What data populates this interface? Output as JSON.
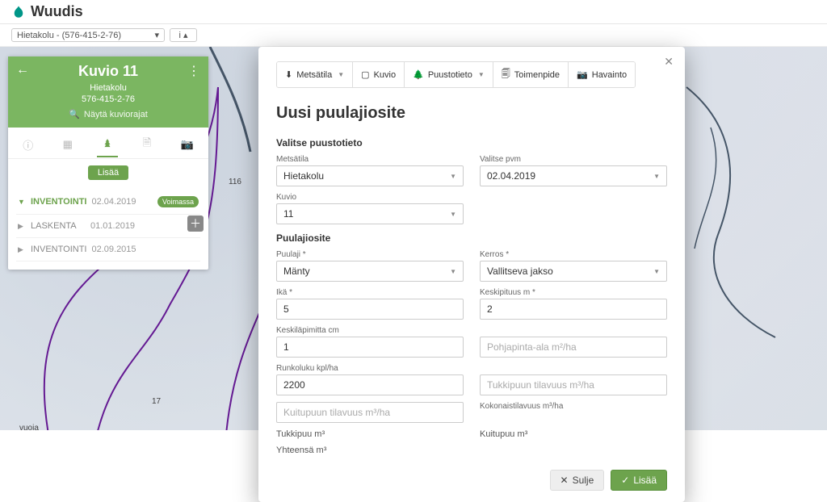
{
  "app": {
    "name": "Wuudis"
  },
  "property_selector": {
    "value": "Hietakolu - (576-415-2-76)"
  },
  "panel": {
    "title": "Kuvio 11",
    "estate": "Hietakolu",
    "estate_id": "576-415-2-76",
    "show_borders": "Näytä kuviorajat",
    "add_label": "Lisää",
    "items": [
      {
        "name": "INVENTOINTI",
        "date": "02.04.2019",
        "badge": "Voimassa",
        "active": true
      },
      {
        "name": "LASKENTA",
        "date": "01.01.2019",
        "badge": "",
        "active": false
      },
      {
        "name": "INVENTOINTI",
        "date": "02.09.2015",
        "badge": "",
        "active": false
      }
    ]
  },
  "modal": {
    "toolbar": {
      "metsatila": "Metsätila",
      "kuvio": "Kuvio",
      "puustotieto": "Puustotieto",
      "toimenpide": "Toimenpide",
      "havainto": "Havainto"
    },
    "title": "Uusi puulajiosite",
    "section_puustotieto": "Valitse puustotieto",
    "metsatila_label": "Metsätila",
    "metsatila_value": "Hietakolu",
    "pvm_label": "Valitse pvm",
    "pvm_value": "02.04.2019",
    "kuvio_label": "Kuvio",
    "kuvio_value": "11",
    "section_puulajiosite": "Puulajiosite",
    "puulaji_label": "Puulaji *",
    "puulaji_value": "Mänty",
    "kerros_label": "Kerros *",
    "kerros_value": "Vallitseva jakso",
    "ika_label": "Ikä *",
    "ika_value": "5",
    "keskipituus_label": "Keskipituus m *",
    "keskipituus_value": "2",
    "keskilapimitta_label": "Keskiläpimitta cm",
    "keskilapimitta_value": "1",
    "pohjapinta_placeholder": "Pohjapinta-ala m²/ha",
    "runkoluku_label": "Runkoluku kpl/ha",
    "runkoluku_value": "2200",
    "tukkipuun_placeholder": "Tukkipuun tilavuus m³/ha",
    "kuitupuun_placeholder": "Kuitupuun tilavuus m³/ha",
    "kokonaistilavuus_label": "Kokonaistilavuus m³/ha",
    "tukkipuu_label": "Tukkipuu m³",
    "kuitupuu_label": "Kuitupuu m³",
    "yhteensa_label": "Yhteensä m³",
    "close": "Sulje",
    "add": "Lisää"
  }
}
